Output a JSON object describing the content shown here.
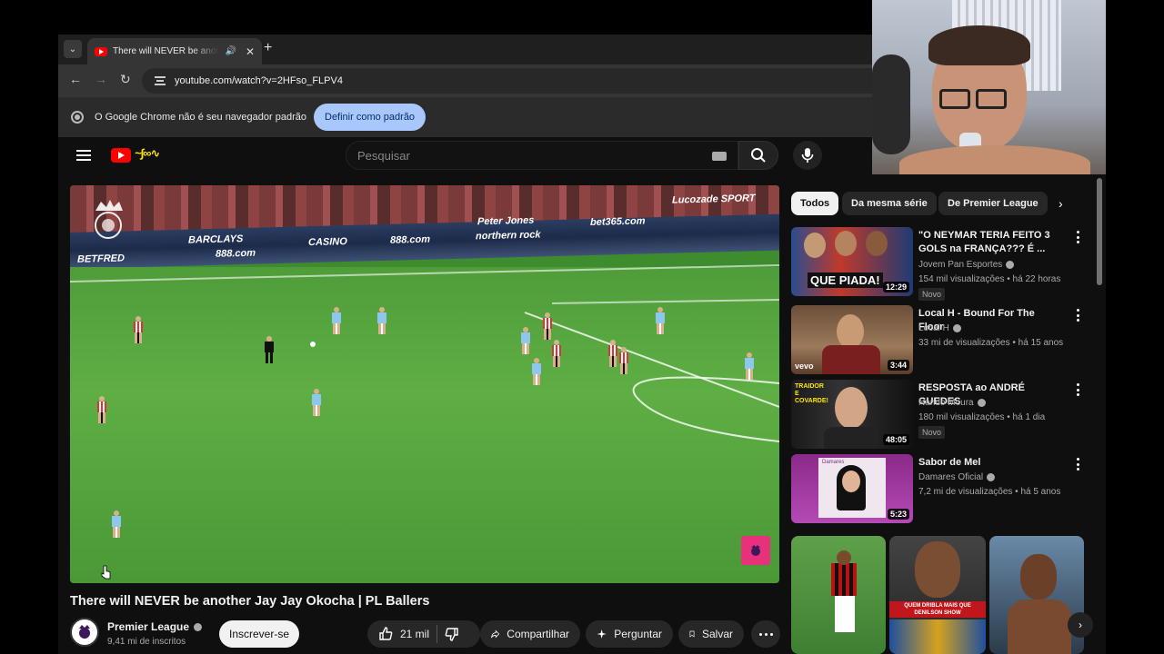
{
  "browser": {
    "tab_title": "There will NEVER be another Jay Jay Okocha | PL Ballers",
    "url": "youtube.com/watch?v=2HFso_FLPV4",
    "infobar_text": "O Google Chrome não é seu navegador padrão",
    "infobar_button": "Definir como padrão"
  },
  "youtube": {
    "search_placeholder": "Pesquisar"
  },
  "video": {
    "title": "There will NEVER be another Jay Jay Okocha | PL Ballers",
    "ads": [
      "BARCLAYS",
      "CASINO",
      "888.com",
      "Peter Jones",
      "northern rock",
      "bet365.com",
      "BETFRED",
      "Lucozade SPORT",
      "888.com"
    ]
  },
  "channel": {
    "name": "Premier League",
    "subscribers": "9,41 mi de inscritos",
    "subscribe_label": "Inscrever-se"
  },
  "actions": {
    "likes": "21 mil",
    "share": "Compartilhar",
    "ask": "Perguntar",
    "save": "Salvar"
  },
  "chips": [
    "Todos",
    "Da mesma série",
    "De Premier League"
  ],
  "recommendations": [
    {
      "title": "\"O NEYMAR TERIA FEITO 3 GOLS na FRANÇA??? É ...",
      "channel": "Jovem Pan Esportes",
      "meta": "154 mil visualizações • há 22 horas",
      "badge": "Novo",
      "duration": "12:29",
      "thumb_text": "QUE PIADA!"
    },
    {
      "title": "Local H - Bound For The Floor",
      "channel": "Local H",
      "meta": "33 mi de visualizações • há 15 anos",
      "badge": "",
      "duration": "3:44",
      "thumb_text": "vevo"
    },
    {
      "title": "RESPOSTA ao ANDRÉ GUEDES",
      "channel": "Nando Moura",
      "meta": "180 mil visualizações • há 1 dia",
      "badge": "Novo",
      "duration": "48:05",
      "thumb_text": "TRAIDOR E COVARDE!"
    },
    {
      "title": "Sabor de Mel",
      "channel": "Damares Oficial",
      "meta": "7,2 mi de visualizações • há 5 anos",
      "badge": "",
      "duration": "5:23",
      "thumb_text": "Damares"
    }
  ],
  "shorts": {
    "middle_caption": "QUEM DRIBLA MAIS QUE DENILSON SHOW"
  },
  "colors": {
    "youtube_red": "#ff0000",
    "subscribe_bg": "#f1f1f1",
    "chrome_button": "#a8c7fa",
    "pitch_green": "#5fae44"
  }
}
